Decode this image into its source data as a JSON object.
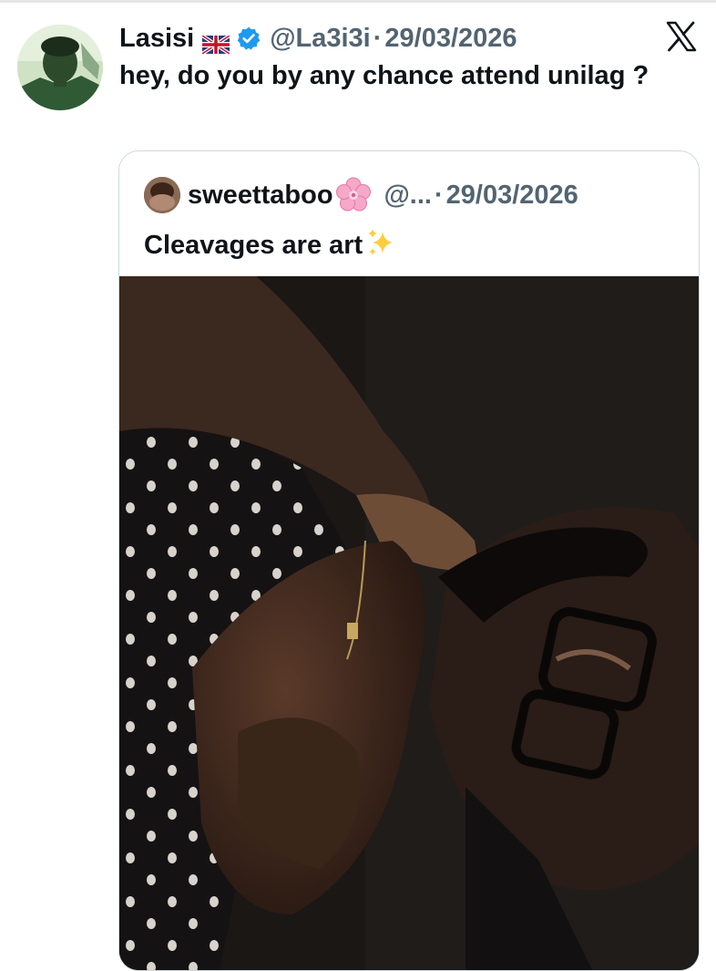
{
  "tweet": {
    "display_name": "Lasisi",
    "handle": "@La3i3i",
    "separator": "·",
    "date": "29/03/2026",
    "text": "hey, do you by any chance attend unilag ?",
    "flag_icon": "uk-flag-icon",
    "verified_icon": "verified-badge-icon",
    "verified_color": "#1d9bf0"
  },
  "quoted": {
    "display_name": "sweettaboo",
    "name_emoji_icon": "cherry-blossom-icon",
    "handle": "@...",
    "separator": "·",
    "date": "29/03/2026",
    "text": "Cleavages are art",
    "text_emoji_icon": "sparkles-icon"
  },
  "brand": {
    "logo_icon": "x-logo-icon"
  }
}
